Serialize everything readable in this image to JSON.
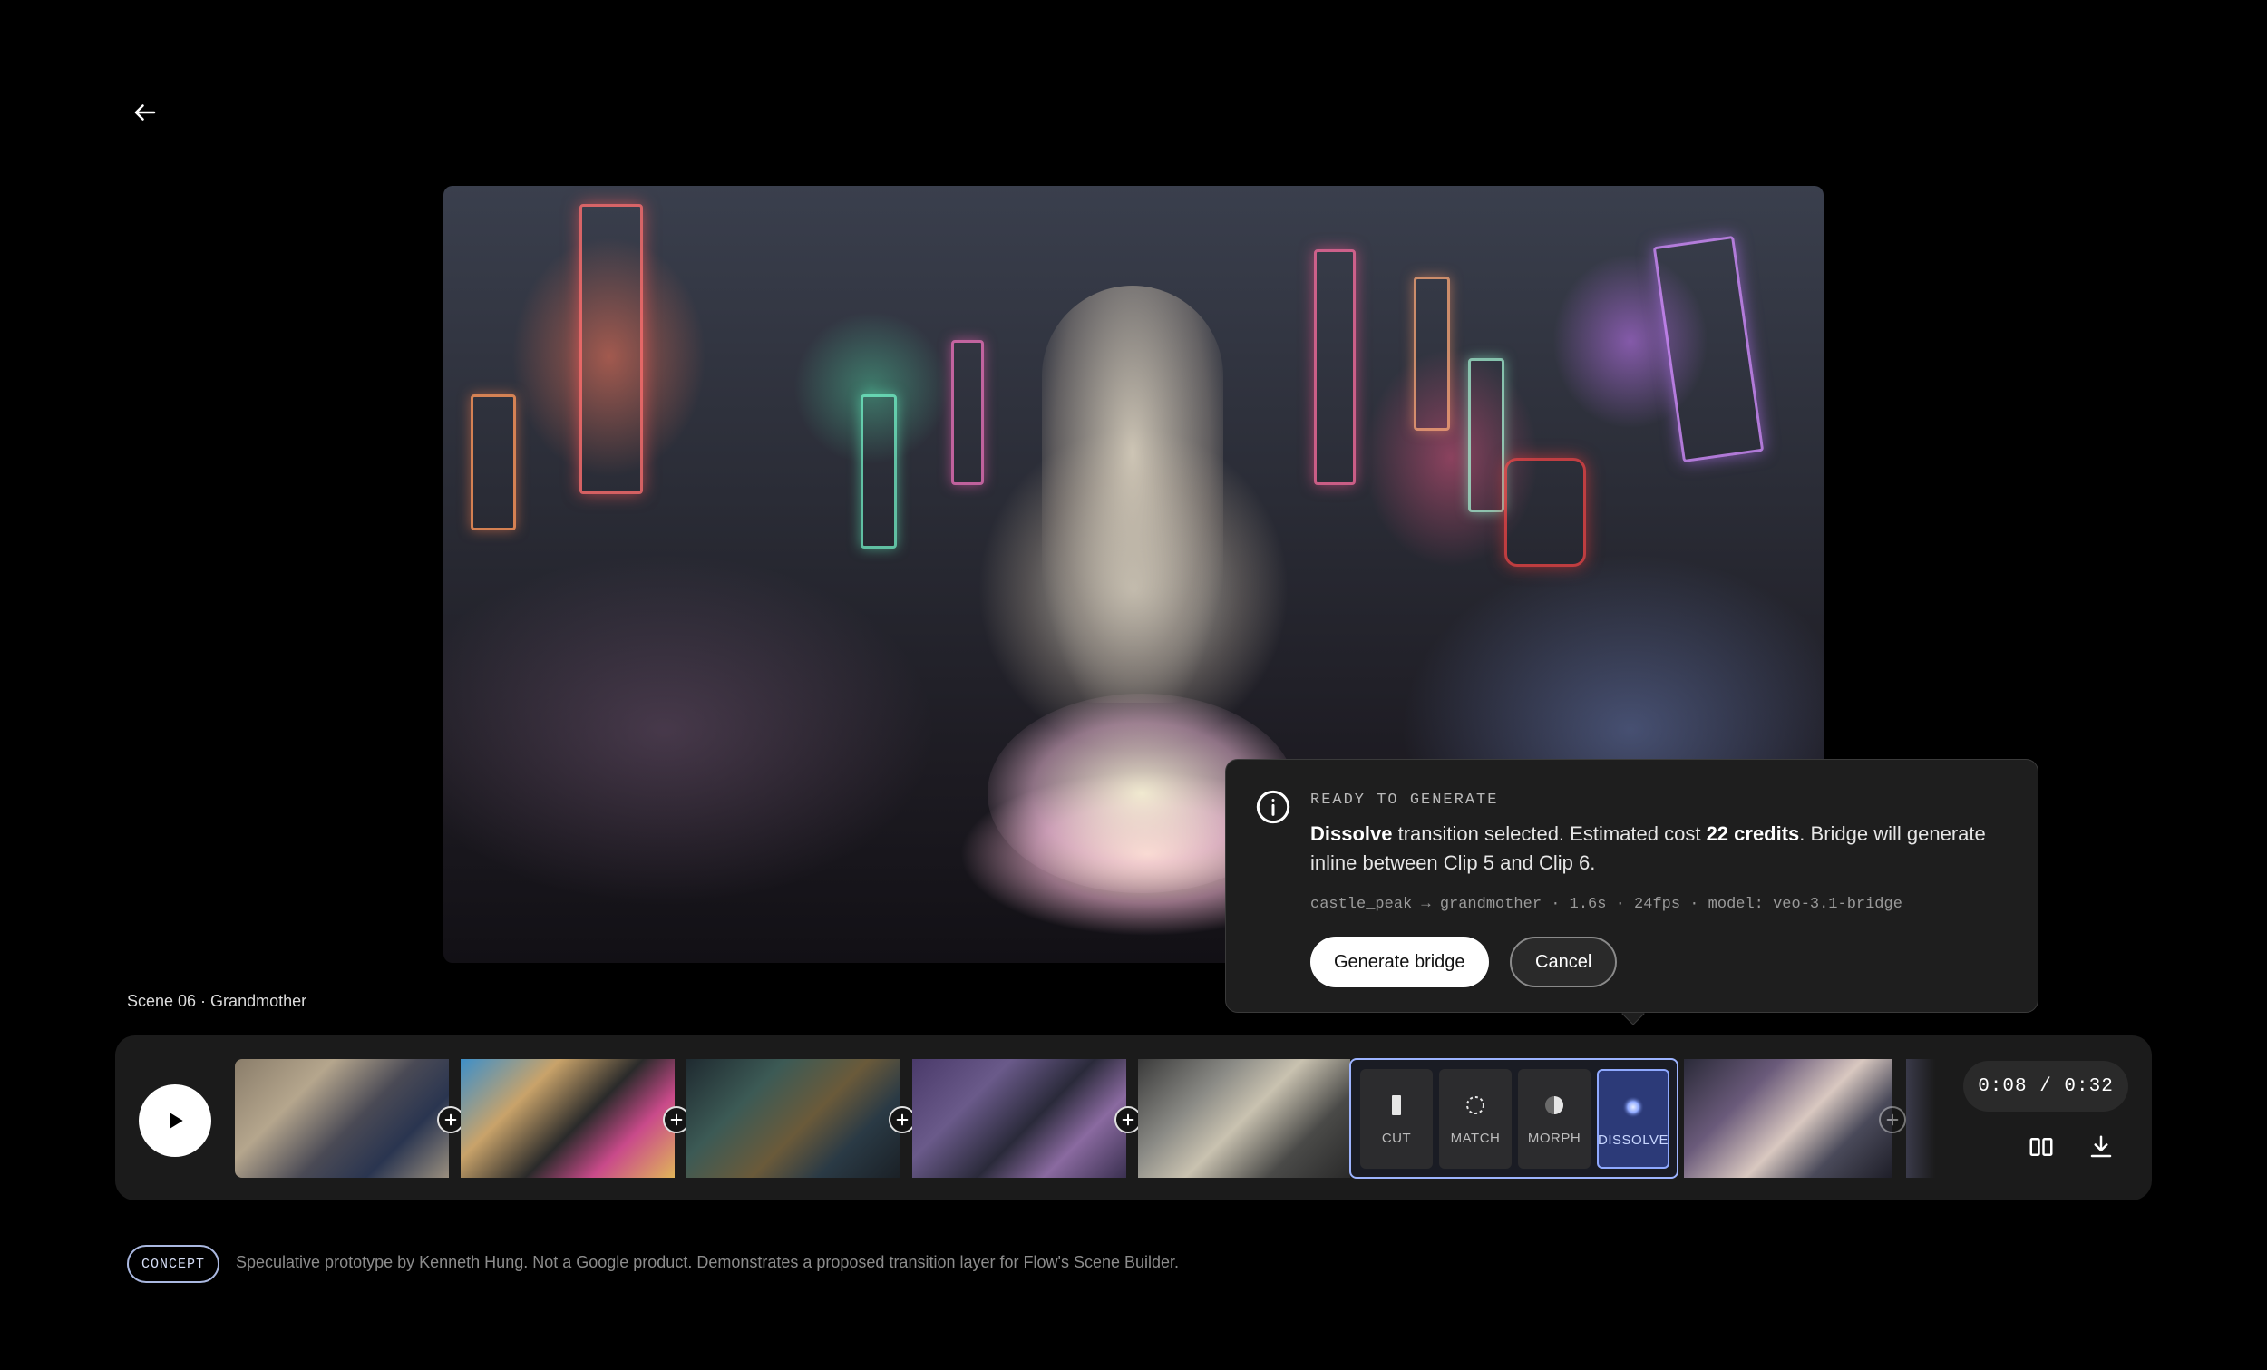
{
  "scene": {
    "label": "Scene 06 · Grandmother"
  },
  "popover": {
    "eyebrow": "READY TO GENERATE",
    "body_strong_1": "Dissolve",
    "body_text_1": " transition selected. Estimated cost ",
    "body_strong_2": "22 credits",
    "body_text_2": ". Bridge will generate inline between Clip 5 and Clip 6.",
    "meta": "castle_peak → grandmother · 1.6s · 24fps · model: veo-3.1-bridge",
    "generate_label": "Generate bridge",
    "cancel_label": "Cancel"
  },
  "transitions": [
    {
      "label": "CUT",
      "icon": "cut-icon"
    },
    {
      "label": "MATCH",
      "icon": "match-icon"
    },
    {
      "label": "MORPH",
      "icon": "morph-icon"
    },
    {
      "label": "DISSOLVE",
      "icon": "dissolve-icon",
      "active": true
    }
  ],
  "timecode": "0:08 / 0:32",
  "footer": {
    "badge": "CONCEPT",
    "disclaimer": "Speculative prototype by Kenneth Hung. Not a Google product. Demonstrates a proposed transition layer for Flow's Scene Builder."
  },
  "colors": {
    "accent": "#8fa9ff",
    "active_bg": "#2c3a78",
    "panel": "#1e1e1e",
    "timeline": "#1b1b1b"
  }
}
